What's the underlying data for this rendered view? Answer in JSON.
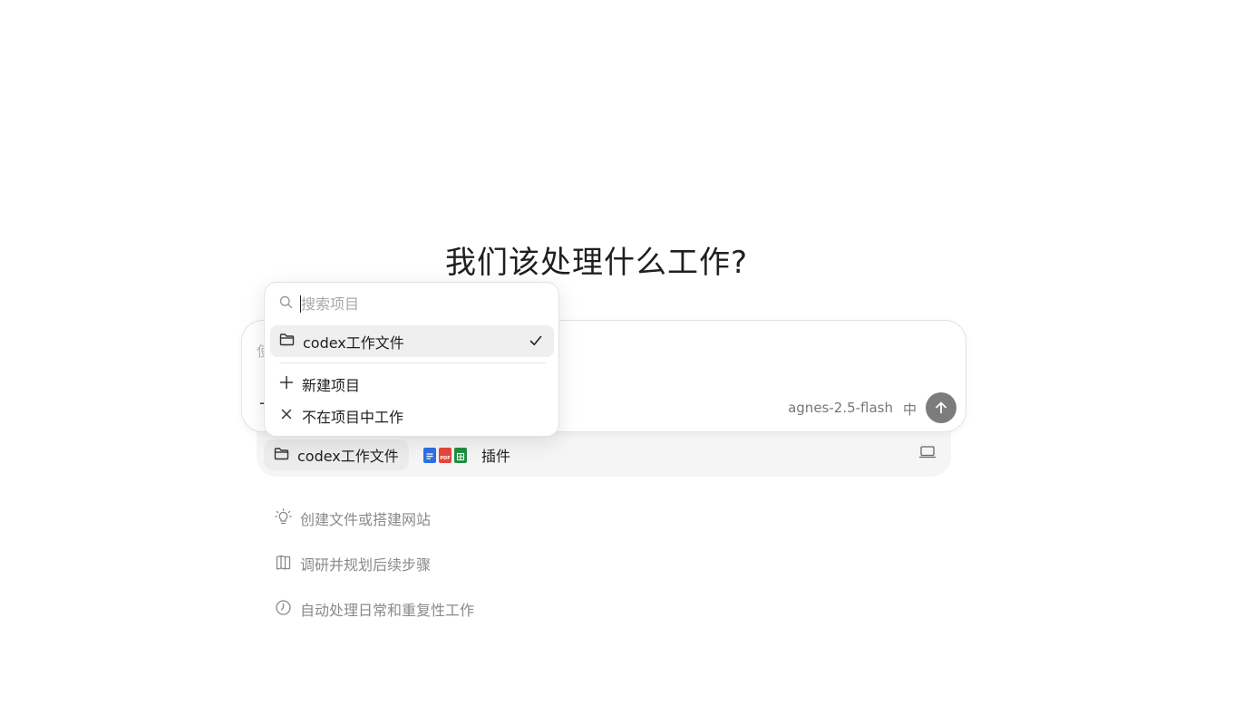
{
  "heading": "我们该处理什么工作?",
  "composer": {
    "placeholder_fragment": "使",
    "add_symbol": "+",
    "model": "agnes-2.5-flash",
    "lang": "中"
  },
  "tray": {
    "project_label": "codex工作文件",
    "plugins_label": "插件",
    "plugin_icons": [
      "docs-icon",
      "pdf-icon",
      "sheets-icon"
    ],
    "pdf_text": "PDF"
  },
  "dropdown": {
    "search_placeholder": "搜索项目",
    "projects": [
      {
        "label": "codex工作文件",
        "selected": true
      }
    ],
    "new_project": "新建项目",
    "no_project": "不在项目中工作"
  },
  "suggestions": [
    {
      "icon": "lightbulb-icon",
      "label": "创建文件或搭建网站"
    },
    {
      "icon": "book-icon",
      "label": "调研并规划后续步骤"
    },
    {
      "icon": "clock-icon",
      "label": "自动处理日常和重复性工作"
    }
  ],
  "colors": {
    "send_button": "#7c7c7c",
    "selected_row": "#efefef",
    "tray_bg": "#f5f5f5",
    "docs_blue": "#2f6fe4",
    "pdf_red": "#e8453c",
    "sheets_green": "#1e8e3e"
  }
}
